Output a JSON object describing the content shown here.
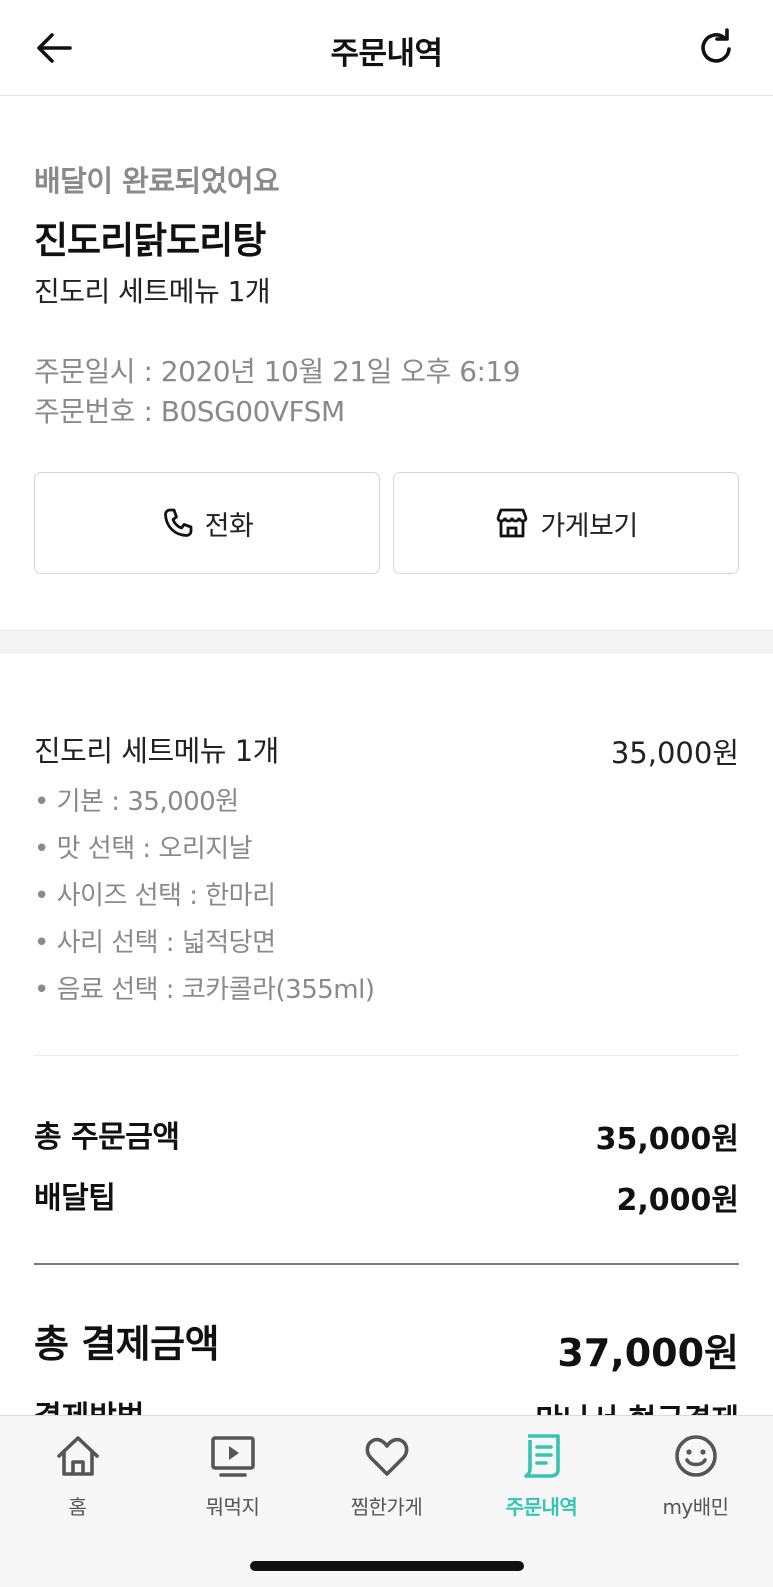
{
  "header": {
    "title": "주문내역",
    "back_icon": "arrow-left-icon",
    "refresh_icon": "refresh-icon"
  },
  "order": {
    "status": "배달이 완료되었어요",
    "store_name": "진도리닭도리탕",
    "summary": "진도리 세트메뉴 1개",
    "date_line": "주문일시 : 2020년 10월 21일 오후 6:19",
    "number_line": "주문번호 : B0SG00VFSM"
  },
  "actions": {
    "call_label": "전화",
    "store_label": "가게보기"
  },
  "item": {
    "name": "진도리 세트메뉴 1개",
    "price": "35,000원",
    "options": [
      "• 기본 : 35,000원",
      "• 맛 선택 : 오리지날",
      "• 사이즈 선택 : 한마리",
      "• 사리 선택 : 넓적당면",
      "• 음료 선택 : 코카콜라(355ml)"
    ]
  },
  "totals": {
    "order_label": "총 주문금액",
    "order_value": "35,000원",
    "tip_label": "배달팁",
    "tip_value": "2,000원",
    "payment_label": "총 결제금액",
    "payment_value": "37,000원",
    "method_label": "결제방법",
    "method_value": "만나서 현금결제"
  },
  "tabs": [
    {
      "label": "홈",
      "icon": "home-icon",
      "active": false
    },
    {
      "label": "뭐먹지",
      "icon": "play-screen-icon",
      "active": false
    },
    {
      "label": "찜한가게",
      "icon": "heart-icon",
      "active": false
    },
    {
      "label": "주문내역",
      "icon": "order-list-icon",
      "active": true
    },
    {
      "label": "my배민",
      "icon": "smiley-icon",
      "active": false
    }
  ],
  "colors": {
    "accent": "#35c5b5",
    "muted_text": "#8a8a8a",
    "tabbar_bg": "#f7f7f7"
  }
}
